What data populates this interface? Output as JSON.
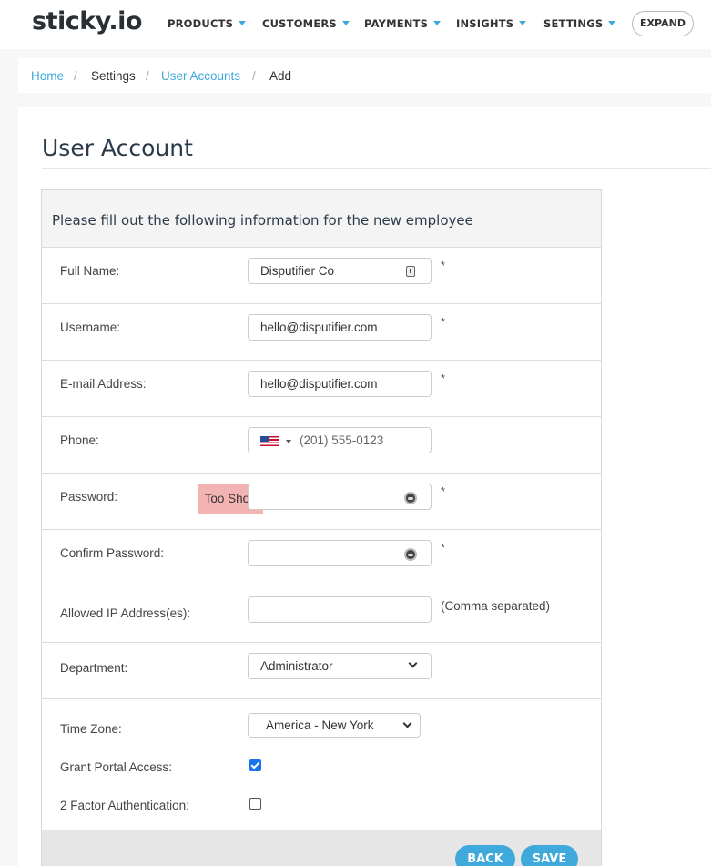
{
  "app": {
    "logo": "sticky.io"
  },
  "nav": {
    "items": [
      {
        "label": "PRODUCTS"
      },
      {
        "label": "CUSTOMERS"
      },
      {
        "label": "PAYMENTS"
      },
      {
        "label": "INSIGHTS"
      },
      {
        "label": "SETTINGS"
      }
    ],
    "expand_label": "EXPAND"
  },
  "breadcrumb": {
    "home": "Home",
    "settings": "Settings",
    "user_accounts": "User Accounts",
    "current": "Add",
    "separator": "/"
  },
  "page": {
    "title": "User Account"
  },
  "form": {
    "heading": "Please fill out the following information for the new employee",
    "required_mark": "*",
    "full_name": {
      "label": "Full Name:",
      "value": "Disputifier Co"
    },
    "username": {
      "label": "Username:",
      "value": "hello@disputifier.com"
    },
    "email": {
      "label": "E-mail Address:",
      "value": "hello@disputifier.com"
    },
    "phone": {
      "label": "Phone:",
      "value": "(201) 555-0123",
      "country_flag": "us-flag-icon"
    },
    "password": {
      "label": "Password:",
      "value": "",
      "strength": "Too Short",
      "strength_color": "#f4b3b3"
    },
    "confirm_password": {
      "label": "Confirm Password:",
      "value": ""
    },
    "allowed_ips": {
      "label": "Allowed IP Address(es):",
      "value": "",
      "hint": "(Comma separated)"
    },
    "department": {
      "label": "Department:",
      "value": "Administrator"
    },
    "time_zone": {
      "label": "Time Zone:",
      "value": "America - New York"
    },
    "portal_access": {
      "label": "Grant Portal Access:",
      "checked": true
    },
    "two_factor": {
      "label": "2 Factor Authentication:",
      "checked": false
    }
  },
  "actions": {
    "back": "BACK",
    "save": "SAVE"
  },
  "colors": {
    "accent": "#3fa9dc",
    "checkbox_on": "#1a73e8"
  }
}
